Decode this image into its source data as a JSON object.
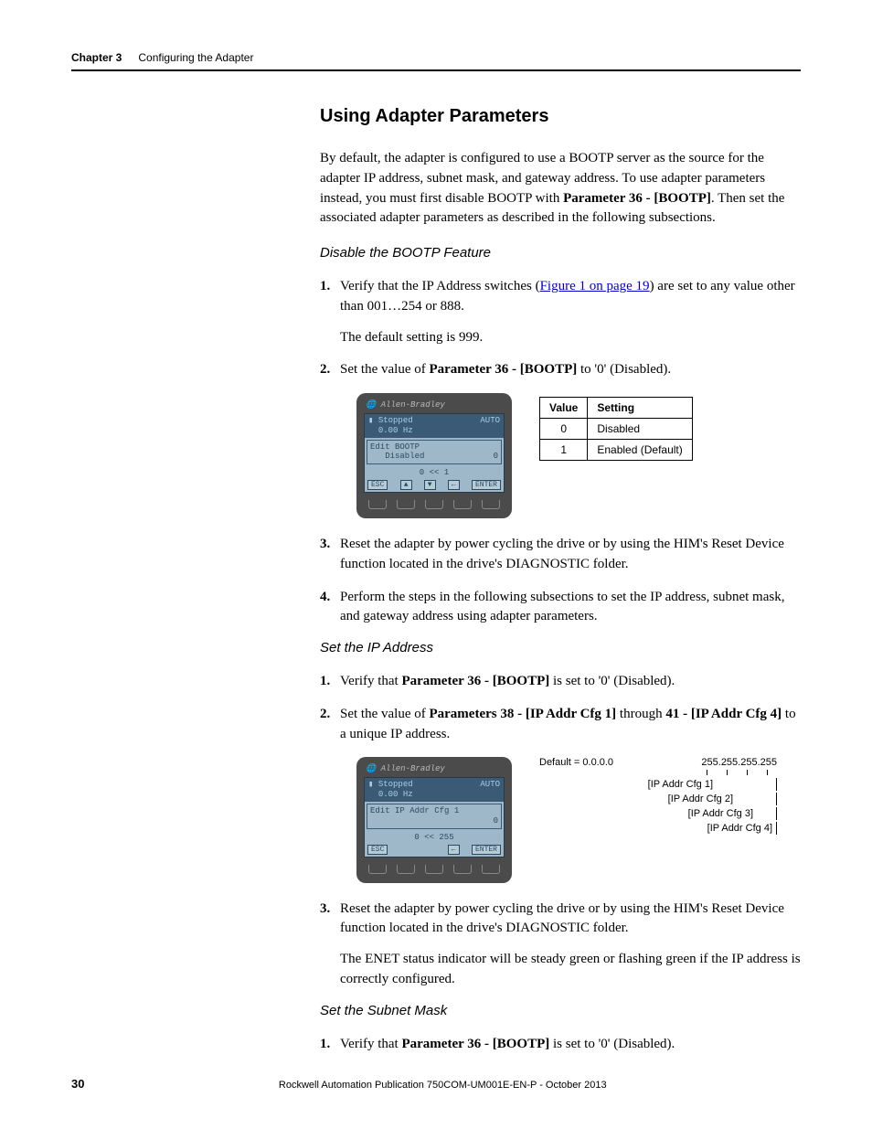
{
  "header": {
    "chapter_label": "Chapter 3",
    "chapter_title": "Configuring the Adapter"
  },
  "section_heading": "Using Adapter Parameters",
  "intro_part1": "By default, the adapter is configured to use a BOOTP server as the source for the adapter IP address, subnet mask, and gateway address. To use adapter parameters instead, you must first disable BOOTP with ",
  "intro_bold": "Parameter 36 - [BOOTP]",
  "intro_part2": ". Then set the associated adapter parameters as described in the following subsections.",
  "sub1": {
    "heading": "Disable the BOOTP Feature",
    "step1_a": "Verify that the IP Address switches (",
    "step1_link": "Figure 1 on page 19",
    "step1_b": ") are set to any value other than 001…254 or 888.",
    "step1_sub": "The default setting is 999.",
    "step2_a": "Set the value of ",
    "step2_bold": "Parameter 36 - [BOOTP]",
    "step2_b": " to '0' (Disabled).",
    "him": {
      "brand": "Allen-Bradley",
      "status1": "Stopped",
      "status2": "AUTO",
      "status3": "0.00 Hz",
      "edit_line1": "Edit BOOTP",
      "edit_line2": "Disabled",
      "edit_val": "0",
      "range": "0  <<  1",
      "esc": "ESC",
      "enter": "ENTER",
      "arrows": [
        "▲",
        "▼",
        "←"
      ]
    },
    "table": {
      "h1": "Value",
      "h2": "Setting",
      "rows": [
        {
          "v": "0",
          "s": "Disabled"
        },
        {
          "v": "1",
          "s": "Enabled (Default)"
        }
      ]
    },
    "step3": "Reset the adapter by power cycling the drive or by using the HIM's Reset Device function located in the drive's DIAGNOSTIC folder.",
    "step4": "Perform the steps in the following subsections to set the IP address, subnet mask, and gateway address using adapter parameters."
  },
  "sub2": {
    "heading": "Set the IP Address",
    "step1_a": "Verify that ",
    "step1_bold": "Parameter 36 - [BOOTP]",
    "step1_b": " is set to '0' (Disabled).",
    "step2_a": "Set the value of ",
    "step2_bold1": "Parameters 38 - [IP Addr Cfg 1]",
    "step2_mid": " through ",
    "step2_bold2": "41 - [IP Addr Cfg 4]",
    "step2_b": " to a unique IP address.",
    "him": {
      "brand": "Allen-Bradley",
      "status1": "Stopped",
      "status2": "AUTO",
      "status3": "0.00 Hz",
      "edit_line1": "Edit IP Addr Cfg 1",
      "edit_val": "0",
      "range": "0  <<  255",
      "esc": "ESC",
      "enter": "ENTER",
      "arrow": "←"
    },
    "diagram": {
      "default": "Default = 0.0.0.0",
      "max": "255.255.255.255",
      "labels": [
        "[IP Addr Cfg 1]",
        "[IP Addr Cfg 2]",
        "[IP Addr Cfg 3]",
        "[IP Addr Cfg 4]"
      ]
    },
    "step3": "Reset the adapter by power cycling the drive or by using the HIM's Reset Device function located in the drive's DIAGNOSTIC folder.",
    "step3_sub": "The ENET status indicator will be steady green or flashing green if the IP address is correctly configured."
  },
  "sub3": {
    "heading": "Set the Subnet Mask",
    "step1_a": "Verify that ",
    "step1_bold": "Parameter 36 - [BOOTP]",
    "step1_b": " is set to '0' (Disabled)."
  },
  "footer": {
    "page": "30",
    "pub": "Rockwell Automation Publication 750COM-UM001E-EN-P - October 2013"
  }
}
